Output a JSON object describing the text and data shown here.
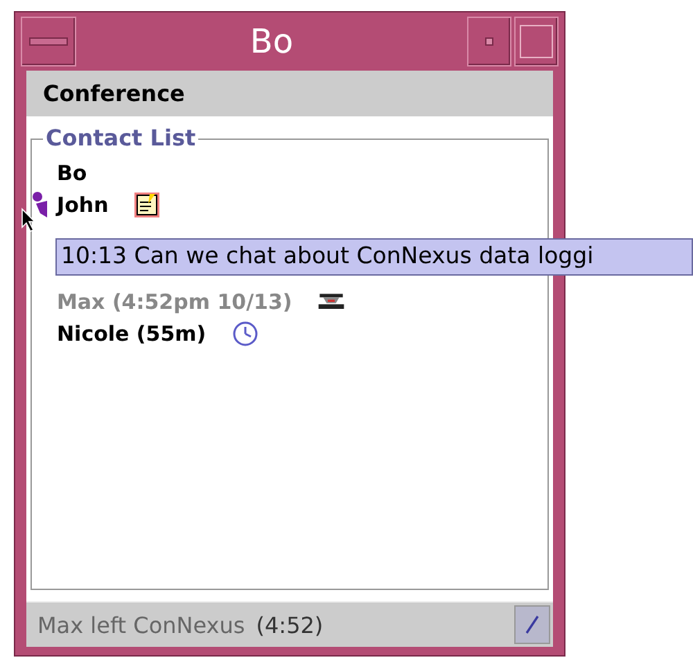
{
  "window": {
    "title": "Bo"
  },
  "menu_bar": {
    "items": [
      "Conference"
    ]
  },
  "contact_list": {
    "title": "Contact List",
    "contacts": [
      {
        "name": "Bo",
        "kind": "online",
        "hovered": false
      },
      {
        "name": "John",
        "kind": "note",
        "hovered": true
      },
      {
        "name": "Max (4:52pm 10/13)",
        "kind": "offline",
        "hovered": false
      },
      {
        "name": "Nicole (55m)",
        "kind": "idle",
        "hovered": false
      }
    ]
  },
  "tooltip": {
    "text": "10:13 Can we chat about ConNexus data loggi"
  },
  "status_bar": {
    "message": "Max left ConNexus",
    "time": "(4:52)"
  }
}
